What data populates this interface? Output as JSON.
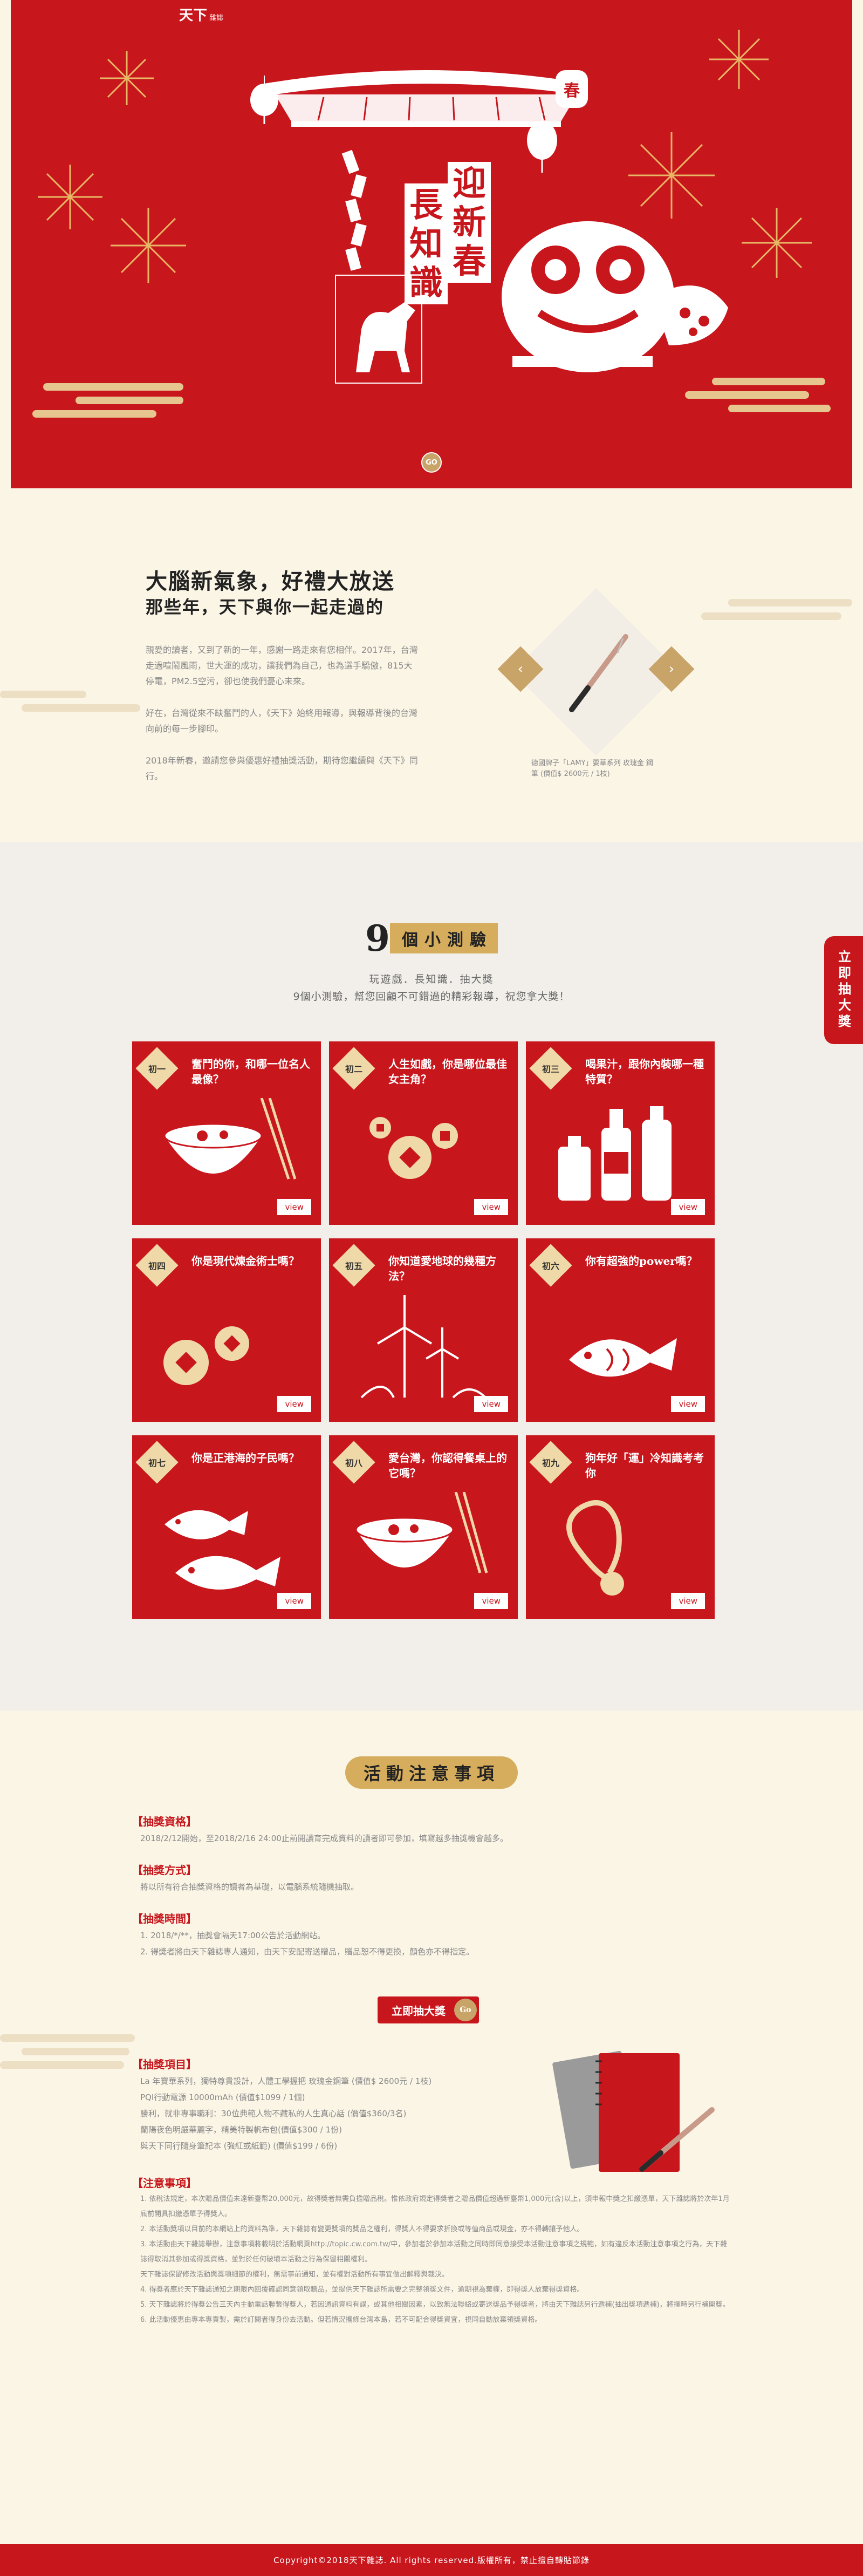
{
  "hero": {
    "logo_main": "天下",
    "logo_sub": "雜誌",
    "title_line1": "迎新春",
    "title_line2": "長知識",
    "lantern_char": "春",
    "go_label": "GO"
  },
  "intro": {
    "headline_1": "大腦新氣象，好禮大放送",
    "headline_2": "那些年，天下與你一起走過的",
    "paragraphs": [
      "親愛的讀者，又到了新的一年，感謝一路走來有您相伴。2017年，台灣走過喧鬧風雨，世大運的成功，讓我們為自己，也為選手驕傲，815大停電，PM2.5空污，卻也使我們憂心未來。",
      "好在，台灣從來不缺奮鬥的人，《天下》始終用報導，與報導背後的台灣向前的每一步腳印。",
      "2018年新春，邀請您參與優惠好禮抽獎活動，期待您繼續與《天下》同行。"
    ],
    "prize_caption": "德國牌子「LAMY」要華系列 玫瑰金 鋼筆 (價值$ 2600元 / 1枝)",
    "prev_icon": "chevron-left-icon",
    "next_icon": "chevron-right-icon"
  },
  "quiz": {
    "title_num": "9",
    "title_text": "個小測驗",
    "subtitle_1": "玩遊戲．長知識．抽大獎",
    "subtitle_2": "9個小測驗，幫您回顧不可錯過的精彩報導，祝您拿大獎！",
    "view_label": "view",
    "items": [
      {
        "badge": "初一",
        "question": "奮鬥的你，和哪一位名人最像？",
        "icon": "soup-bowl-icon"
      },
      {
        "badge": "初二",
        "question": "人生如戲，你是哪位最佳女主角？",
        "icon": "coins-icon"
      },
      {
        "badge": "初三",
        "question": "喝果汁，跟你內裝哪一種特質？",
        "icon": "bottles-icon"
      },
      {
        "badge": "初四",
        "question": "你是現代煉金術士嗎？",
        "icon": "coins-icon"
      },
      {
        "badge": "初五",
        "question": "你知道愛地球的幾種方法？",
        "icon": "wind-turbine-icon"
      },
      {
        "badge": "初六",
        "question": "你有超強的power嗎？",
        "icon": "fish-icon"
      },
      {
        "badge": "初七",
        "question": "你是正港海的子民嗎？",
        "icon": "fish-icon"
      },
      {
        "badge": "初八",
        "question": "愛台灣，你認得餐桌上的它嗎？",
        "icon": "soup-bowl-icon"
      },
      {
        "badge": "初九",
        "question": "狗年好「運」冷知識考考你",
        "icon": "medal-icon"
      }
    ]
  },
  "side_tab": {
    "label": "立即抽大獎"
  },
  "notice": {
    "title": "活動注意事項",
    "sections": [
      {
        "heading": "【抽獎資格】",
        "lines": [
          "2018/2/12開始，至2018/2/16 24:00止前閱讀育完成資料的讀者即可參加，填寫越多抽獎機會越多。"
        ]
      },
      {
        "heading": "【抽獎方式】",
        "lines": [
          "將以所有符合抽獎資格的讀者為基礎，以電腦系統隨機抽取。"
        ]
      },
      {
        "heading": "【抽獎時間】",
        "lines": [
          "1. 2018/*/**，抽獎會隔天17:00公告於活動網站。",
          "2. 得獎者將由天下雜誌專人通知，由天下安配寄送贈品，贈品恕不得更換，顏色亦不得指定。"
        ]
      }
    ],
    "draw_button": "立即抽大獎",
    "draw_go": "Go",
    "prize_heading": "【抽獎項目】",
    "prize_lines": [
      "La 年寶華系列，獨特尊貴設計，人體工學握把 玫瑰金鋼筆 (價值$ 2600元 / 1枝)",
      "PQI行動電源 10000mAh (價值$1099 / 1個)",
      "勝利，就非專事職利：30位典範人物不藏私的人生真心話 (價值$360/3名)",
      "蘭陽夜色明嚴華麗字，精美特製帆布包(價值$300 / 1份)",
      "與天下同行隨身筆記本 (強紅或紙範) (價值$199 / 6份)"
    ],
    "rules_heading": "【注意事項】",
    "rules_lines": [
      "1. 依稅法規定，本次贈品價值未達新臺幣20,000元，故得獎者無需負擔贈品稅。惟依政府規定得獎者之贈品價值超過新臺幣1,000元(含)以上，須申報中獎之扣繳憑單，天下雜誌將於次年1月底前開具扣繳憑單予得獎人。",
      "2. 本活動獎項以目前的本網站上的資料為準，天下雜誌有變更獎項的獎品之權利，得獎人不得要求折換或等值商品或現金，亦不得轉讓予他人。",
      "3. 本活動由天下雜誌舉辦，注意事項將載明於活動網頁http://topic.cw.com.tw/中，參加者於參加本活動之同時即同意接受本活動注意事項之規範，如有違反本活動注意事項之行為，天下雜誌得取消其參加或得獎資格，並對於任何破壞本活動之行為保留相關權利。",
      "天下雜誌保留修改活動與獎項細節的權利，無需事前通知，並有權對活動所有事宜做出解釋與裁決。",
      "4. 得獎者應於天下雜誌通知之期限內回覆確認同意領取贈品，並提供天下雜誌所需要之完整領獎文件，逾期視為棄權，即得獎人放棄得獎資格。",
      "5. 天下雜誌將於得獎公告三天內主動電話聯繫得獎人，若因通訊資料有誤，或其他相關因素，以致無法聯絡或寄送獎品予得獎者，將由天下雜誌另行遞補(抽出獎項遞補)，將擇時另行補開獎。",
      "6. 此活動優惠由專本專責製，需於訂閱者得身份去活動。但若情況攜條台灣本島，若不可配合得獎資宜，視同自動放棄領獎資格。"
    ]
  },
  "footer": {
    "copyright": "Copyright©2018天下雜誌. All rights reserved.版權所有，禁止擅自轉貼節錄"
  },
  "colors": {
    "primary_red": "#c8161d",
    "gold": "#c9a469",
    "cream": "#fbf5e6"
  }
}
